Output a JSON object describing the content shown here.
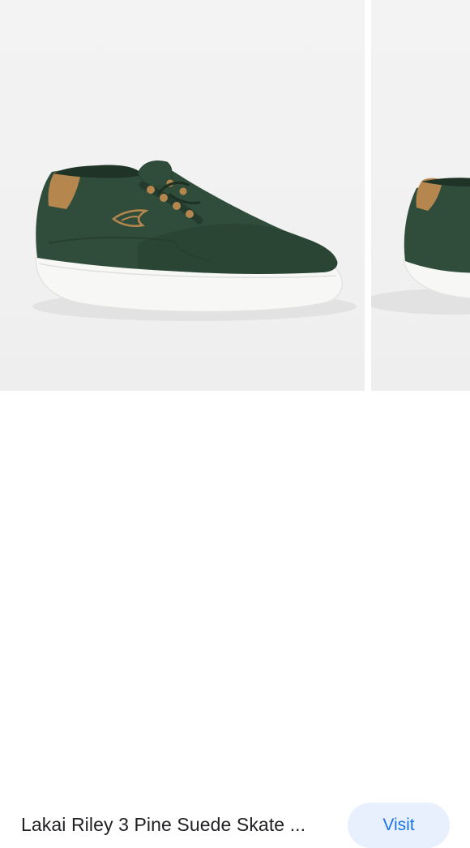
{
  "result": {
    "title": "Lakai Riley 3 Pine Suede Skate ...",
    "visit_label": "Visit"
  },
  "images": [
    {
      "name": "main-product-photo",
      "subject": "green-suede-skate-shoe"
    },
    {
      "name": "next-product-photo",
      "subject": "green-suede-skate-shoe"
    }
  ],
  "colors": {
    "shoe_green": "#2f4d3a",
    "tan_accent": "#b5874f",
    "sole_white": "#f7f7f5",
    "link_blue": "#1a73e8",
    "button_bg": "#e8f0fe"
  }
}
